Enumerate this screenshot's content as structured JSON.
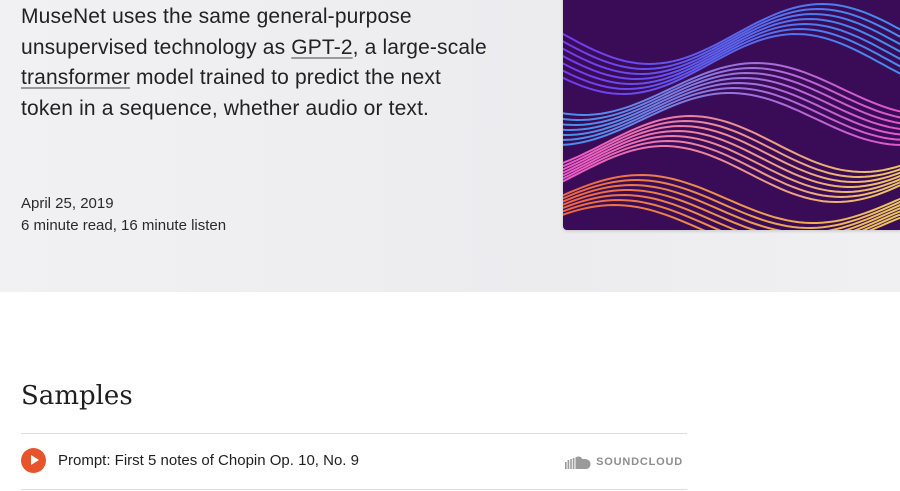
{
  "article": {
    "intro_before_gpt2": "MuseNet uses the same general-purpose unsupervised technology as ",
    "gpt2_link": "GPT-2",
    "intro_between": ", a large-scale ",
    "transformer_link": "transformer",
    "intro_after": " model trained to predict the next token in a sequence, whether audio or text.",
    "date": "April 25, 2019",
    "read_time": "6 minute read, 16 minute listen"
  },
  "hero_image": {
    "background": "#3a0b57",
    "palette": [
      "#7b3bff",
      "#3fa3ff",
      "#ff5bd6",
      "#ffe15a",
      "#ff6a3d"
    ]
  },
  "samples": {
    "title": "Samples",
    "items": [
      {
        "label": "Prompt: First 5 notes of Chopin Op. 10, No. 9",
        "provider": "SOUNDCLOUD",
        "accent": "#e7542b"
      }
    ]
  }
}
